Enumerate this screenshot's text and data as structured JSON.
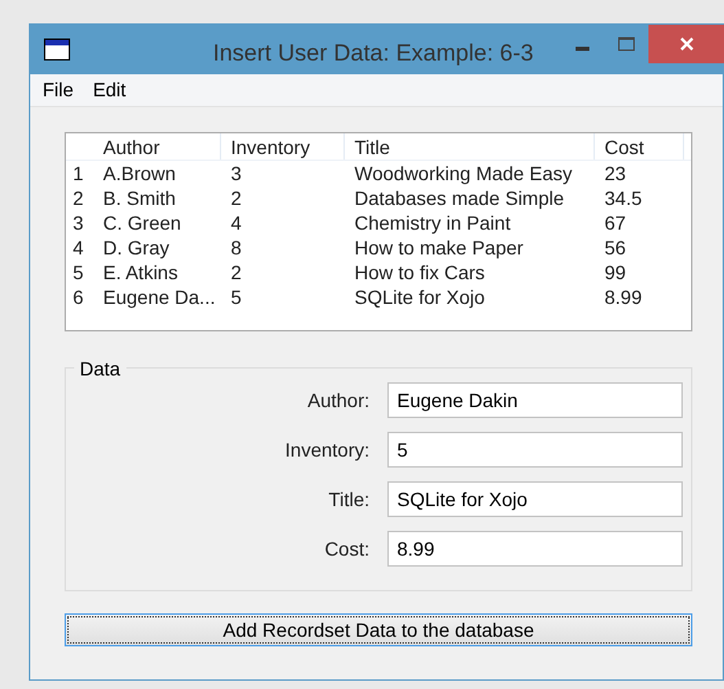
{
  "window": {
    "title": "Insert User Data: Example: 6-3"
  },
  "menu": [
    "File",
    "Edit"
  ],
  "table": {
    "columns": [
      "Author",
      "Inventory",
      "Title",
      "Cost"
    ],
    "rows": [
      {
        "number": "1",
        "cells": [
          "A.Brown",
          "3",
          "Woodworking Made Easy",
          "23"
        ]
      },
      {
        "number": "2",
        "cells": [
          "B. Smith",
          "2",
          "Databases made Simple",
          "34.5"
        ]
      },
      {
        "number": "3",
        "cells": [
          "C. Green",
          "4",
          "Chemistry in Paint",
          "67"
        ]
      },
      {
        "number": "4",
        "cells": [
          "D. Gray",
          "8",
          "How to make Paper",
          "56"
        ]
      },
      {
        "number": "5",
        "cells": [
          "E. Atkins",
          "2",
          "How to fix Cars",
          "99"
        ]
      },
      {
        "number": "6",
        "cells": [
          "Eugene Da...",
          "5",
          "SQLite for Xojo",
          "8.99"
        ]
      }
    ]
  },
  "group": {
    "title": "Data",
    "fields": [
      {
        "label": "Author:",
        "value": "Eugene Dakin"
      },
      {
        "label": "Inventory:",
        "value": "5"
      },
      {
        "label": "Title:",
        "value": "SQLite for Xojo"
      },
      {
        "label": "Cost:",
        "value": "8.99"
      }
    ]
  },
  "button": {
    "label": "Add Recordset Data to the database"
  }
}
